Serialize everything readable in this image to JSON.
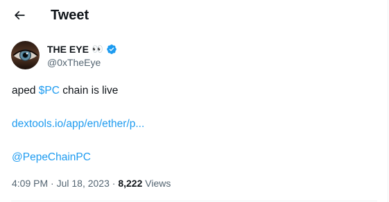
{
  "header": {
    "title": "Tweet",
    "back_icon": "arrow-left-icon"
  },
  "author": {
    "display_name": "THE EYE",
    "emoji": "👀",
    "verified_icon": "verified-badge-icon",
    "handle": "@0xTheEye"
  },
  "tweet": {
    "text_prefix": "aped ",
    "cashtag": "$PC",
    "text_suffix": " chain is live",
    "link": "dextools.io/app/en/ether/p...",
    "mention": "@PepeChainPC"
  },
  "meta": {
    "time": "4:09 PM",
    "date": "Jul 18, 2023",
    "views_count": "8,222",
    "views_label": "Views"
  },
  "colors": {
    "accent": "#1d9bf0",
    "text": "#0f1419",
    "secondary": "#536471"
  }
}
